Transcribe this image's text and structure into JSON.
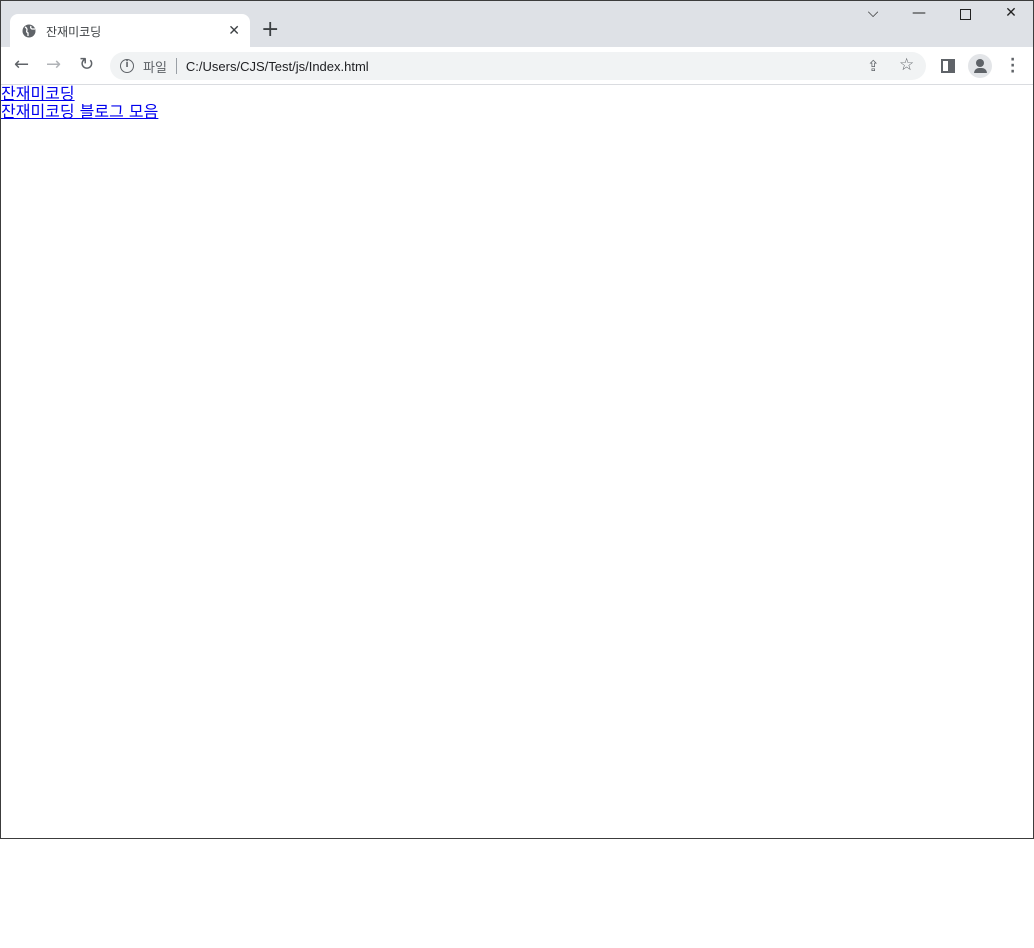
{
  "browser": {
    "tab_title": "잔재미코딩",
    "tab_icon": "globe-icon",
    "address_scheme_label": "파일",
    "address_url": "C:/Users/CJS/Test/js/Index.html"
  },
  "page": {
    "links": [
      "잔재미코딩",
      "잔재미코딩 블로그 모음"
    ]
  },
  "colors": {
    "link": "#0000ee",
    "tabbar": "#dee1e6"
  }
}
